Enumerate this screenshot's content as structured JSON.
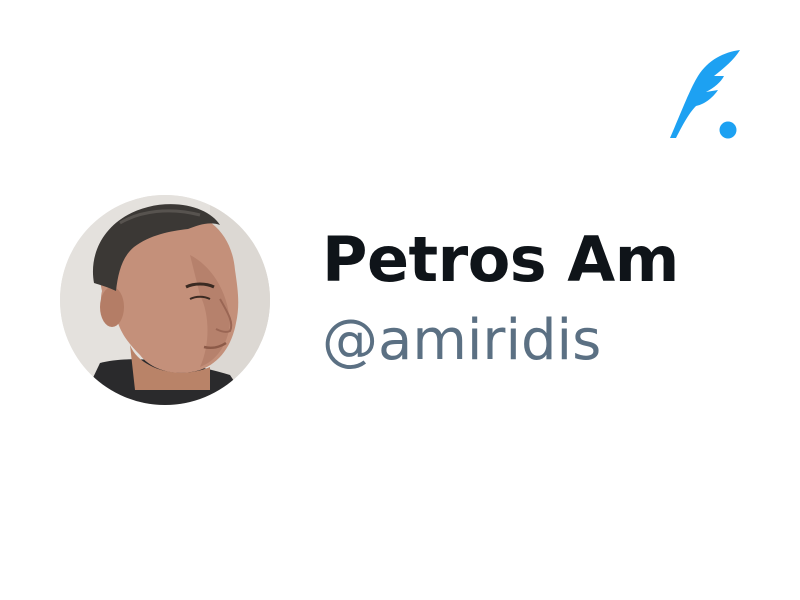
{
  "profile": {
    "display_name": "Petros Amiridis",
    "handle": "@amiridis"
  },
  "icons": {
    "logo": "quill-dot-logo-icon",
    "avatar": "profile-photo"
  },
  "colors": {
    "brand": "#1da1f2",
    "name": "#0f1419",
    "handle": "#5b7083",
    "background": "#ffffff"
  }
}
